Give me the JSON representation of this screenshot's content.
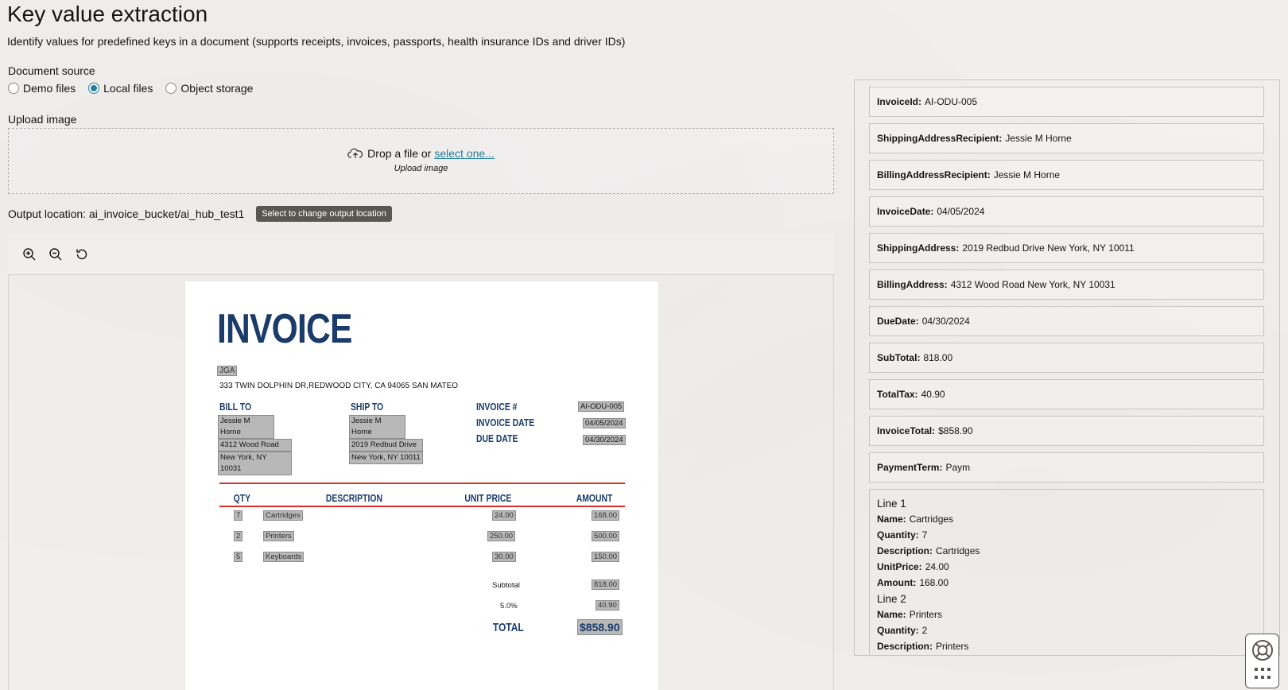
{
  "page": {
    "title": "Key value extraction",
    "subtitle": "Identify values for predefined keys in a document (supports receipts, invoices, passports, health insurance IDs and driver IDs)"
  },
  "document_source": {
    "label": "Document source",
    "options": [
      "Demo files",
      "Local files",
      "Object storage"
    ],
    "selected": "Local files"
  },
  "upload": {
    "label": "Upload image",
    "drop_text": "Drop a file or",
    "link_text": "select one...",
    "hint": "Upload image"
  },
  "output": {
    "label": "Output location: ai_invoice_bucket/ai_hub_test1",
    "button": "Select to change output location"
  },
  "toolbar": {
    "icons": [
      "zoom-in-icon",
      "zoom-out-icon",
      "reset-icon"
    ]
  },
  "invoice": {
    "title": "INVOICE",
    "company": "JGA",
    "address": "333 TWIN DOLPHIN DR,REDWOOD CITY, CA 94065 SAN MATEO",
    "bill_to_head": "BILL TO",
    "bill_to": [
      "Jessie M Horne",
      "4312 Wood Road",
      "New York, NY 10031"
    ],
    "ship_to_head": "SHIP TO",
    "ship_to": [
      "Jessie M Horne",
      "2019 Redbud Drive",
      "New York, NY 10011"
    ],
    "invoice_no_head": "INVOICE #",
    "invoice_no": "AI-ODU-005",
    "invoice_date_head": "INVOICE DATE",
    "invoice_date": "04/05/2024",
    "due_date_head": "DUE DATE",
    "due_date": "04/30/2024",
    "columns": [
      "QTY",
      "DESCRIPTION",
      "UNIT PRICE",
      "AMOUNT"
    ],
    "rows": [
      {
        "qty": "7",
        "desc": "Cartridges",
        "price": "24.00",
        "amount": "168.00"
      },
      {
        "qty": "2",
        "desc": "Printers",
        "price": "250.00",
        "amount": "500.00"
      },
      {
        "qty": "5",
        "desc": "Keyboards",
        "price": "30.00",
        "amount": "150.00"
      }
    ],
    "subtotal_label": "Subtotal",
    "subtotal": "818.00",
    "tax_label": "5.0%",
    "tax": "40.90",
    "total_label": "TOTAL",
    "total": "$858.90"
  },
  "results": {
    "fields": [
      {
        "key": "InvoiceId:",
        "value": "AI-ODU-005"
      },
      {
        "key": "ShippingAddressRecipient:",
        "value": "Jessie M Horne"
      },
      {
        "key": "BillingAddressRecipient:",
        "value": "Jessie M Horne"
      },
      {
        "key": "InvoiceDate:",
        "value": "04/05/2024"
      },
      {
        "key": "ShippingAddress:",
        "value": "2019 Redbud Drive New York, NY 10011"
      },
      {
        "key": "BillingAddress:",
        "value": "4312 Wood Road New York, NY 10031"
      },
      {
        "key": "DueDate:",
        "value": "04/30/2024"
      },
      {
        "key": "SubTotal:",
        "value": "818.00"
      },
      {
        "key": "TotalTax:",
        "value": "40.90"
      },
      {
        "key": "InvoiceTotal:",
        "value": "$858.90"
      },
      {
        "key": "PaymentTerm:",
        "value": "Paym"
      }
    ],
    "lines": [
      {
        "title": "Line 1",
        "fields": [
          {
            "key": "Name:",
            "value": "Cartridges"
          },
          {
            "key": "Quantity:",
            "value": "7"
          },
          {
            "key": "Description:",
            "value": "Cartridges"
          },
          {
            "key": "UnitPrice:",
            "value": "24.00"
          },
          {
            "key": "Amount:",
            "value": "168.00"
          }
        ]
      },
      {
        "title": "Line 2",
        "fields": [
          {
            "key": "Name:",
            "value": "Printers"
          },
          {
            "key": "Quantity:",
            "value": "2"
          },
          {
            "key": "Description:",
            "value": "Printers"
          }
        ]
      }
    ]
  },
  "colors": {
    "accent": "#227e9e",
    "invoice_blue": "#1b3c6b",
    "invoice_red": "#d9302b",
    "button_dark": "#5a5753"
  }
}
